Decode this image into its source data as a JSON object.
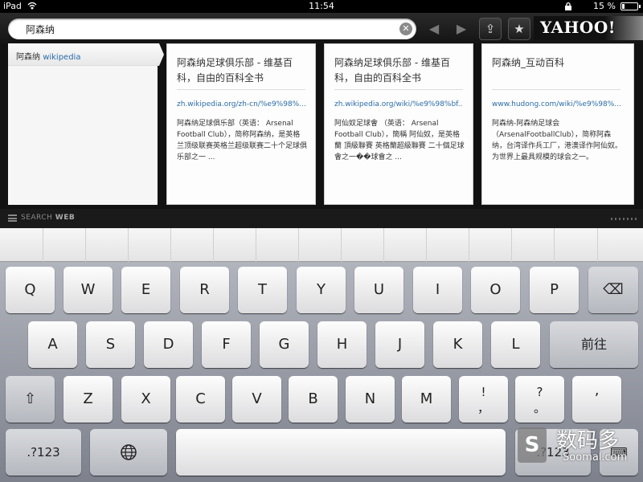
{
  "status_bar": {
    "device": "iPad",
    "time": "11:54",
    "battery": "15 %"
  },
  "search": {
    "query": "阿森纳",
    "clear_glyph": "✕"
  },
  "toolbar": {
    "back_glyph": "◀",
    "forward_glyph": "▶",
    "share_glyph": "⇪",
    "bookmark_glyph": "★",
    "logo": "YAHOO!"
  },
  "suggestions": [
    {
      "prefix": "阿森纳 ",
      "highlight": "wikipedia"
    }
  ],
  "results": [
    {
      "title": "阿森纳足球俱乐部 - 维基百科，自由的百科全书",
      "url": "zh.wikipedia.org/zh-cn/%e9%98%...",
      "snippet": "阿森纳足球俱乐部（英语： Arsenal Football Club），简称阿森纳，是英格兰顶级联赛英格兰超级联赛二十个足球俱乐部之一 ..."
    },
    {
      "title": "阿森纳足球俱乐部 - 维基百科，自由的百科全书",
      "url": "zh.wikipedia.org/wiki/%e9%98%bf...",
      "snippet": "阿仙奴足球會 （英语： Arsenal Football Club），簡稱 阿仙奴，是英格蘭 頂級聯賽 英格蘭超級聯賽 二十個足球會之一��球會之 ..."
    },
    {
      "title": "阿森纳_互动百科",
      "url": "www.hudong.com/wiki/%e9%98%...",
      "snippet": "阿森纳-阿森纳足球会（ArsenalFootballClub），简称阿森纳，台湾译作兵工厂，港澳译作阿仙奴。为世界上最具规模的球会之一。"
    }
  ],
  "search_web": {
    "prefix": "SEARCH ",
    "bold": "WEB"
  },
  "keyboard": {
    "row1": [
      "Q",
      "W",
      "E",
      "R",
      "T",
      "Y",
      "U",
      "I",
      "O",
      "P"
    ],
    "backspace_glyph": "⌫",
    "row2": [
      "A",
      "S",
      "D",
      "F",
      "G",
      "H",
      "J",
      "K",
      "L"
    ],
    "return_label": "前往",
    "shift_glyph": "⇧",
    "row3": [
      "Z",
      "X",
      "C",
      "V",
      "B",
      "N",
      "M"
    ],
    "punct1_top": "!",
    "punct1_bottom": "，",
    "punct2_top": "?",
    "punct2_bottom": "。",
    "punct3": "’",
    "numbers_label": ".?123",
    "globe_glyph": "🌐",
    "numbers_label_right": ".?123",
    "hide_glyph": "⌨"
  },
  "watermark": {
    "logo": "S",
    "cn": "数码多",
    "en": "Soomal.com"
  }
}
